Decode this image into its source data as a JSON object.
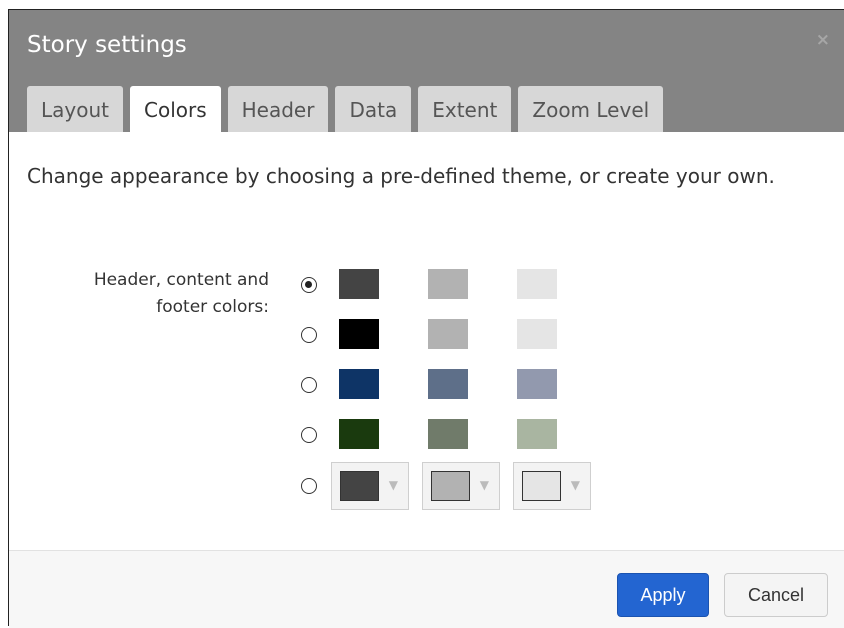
{
  "dialog": {
    "title": "Story settings",
    "close": "×",
    "tabs": [
      {
        "label": "Layout",
        "active": false
      },
      {
        "label": "Colors",
        "active": true
      },
      {
        "label": "Header",
        "active": false
      },
      {
        "label": "Data",
        "active": false
      },
      {
        "label": "Extent",
        "active": false
      },
      {
        "label": "Zoom Level",
        "active": false
      }
    ],
    "description": "Change appearance by choosing a pre-defined theme, or create your own.",
    "theme_label_line1": "Header, content and",
    "theme_label_line2": "footer colors:",
    "themes": [
      {
        "selected": true,
        "colors": [
          "#444444",
          "#b2b2b2",
          "#e5e5e5"
        ]
      },
      {
        "selected": false,
        "colors": [
          "#000000",
          "#b2b2b2",
          "#e5e5e5"
        ]
      },
      {
        "selected": false,
        "colors": [
          "#0e3466",
          "#5e6f89",
          "#9299ae"
        ]
      },
      {
        "selected": false,
        "colors": [
          "#1a3a0e",
          "#707b6a",
          "#a9b5a1"
        ]
      }
    ],
    "custom": {
      "selected": false,
      "colors": [
        "#444444",
        "#b2b2b2",
        "#e5e5e5"
      ],
      "arrow": "▼"
    },
    "footer": {
      "apply_label": "Apply",
      "cancel_label": "Cancel"
    }
  }
}
